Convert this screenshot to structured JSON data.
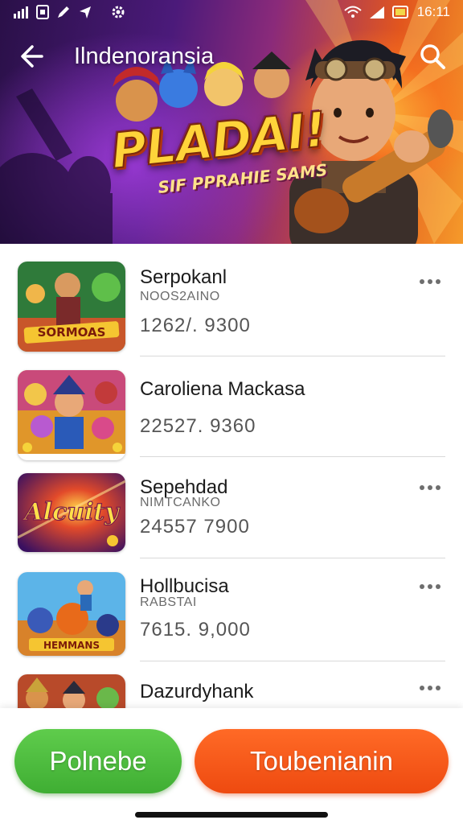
{
  "status_bar": {
    "time": "16:11",
    "icons": [
      "signal-icon",
      "sim-icon",
      "edit-icon",
      "navigation-icon",
      "settings-cog-icon",
      "wifi-icon",
      "cell-signal-icon",
      "battery-icon"
    ]
  },
  "app_bar": {
    "title": "Ilndenoransia",
    "back_icon": "arrow-left-icon",
    "search_icon": "search-icon"
  },
  "hero": {
    "logo_text": "PLADAI!",
    "tagline": "SIF PPRAHIE SAMS"
  },
  "list": {
    "items": [
      {
        "title": "Serpokanl",
        "subtitle": "NOOS2AINO",
        "number": "1262/. 9300",
        "thumb_text": "SORMOAS",
        "thumb_theme": "green-hero",
        "more_icon": "more-horizontal-icon"
      },
      {
        "title": "Caroliena Mackasa",
        "subtitle": "",
        "number": "22527. 9360",
        "thumb_text": "",
        "thumb_theme": "crowd",
        "more_icon": ""
      },
      {
        "title": "Sepehdad",
        "subtitle": "NIMTCANKO",
        "number": "24557 7900",
        "thumb_text": "Alcuity",
        "thumb_theme": "purple-logo",
        "more_icon": "more-horizontal-icon"
      },
      {
        "title": "Hollbucisa",
        "subtitle": "RABSTAI",
        "number": "7615. 9,000",
        "thumb_text": "HEMMANS",
        "thumb_theme": "sky-heroes",
        "more_icon": "more-horizontal-icon"
      },
      {
        "title": "Dazurdyhank",
        "subtitle": "",
        "number": "",
        "thumb_text": "",
        "thumb_theme": "warriors",
        "more_icon": "more-horizontal-icon"
      }
    ]
  },
  "buttons": {
    "left_label": "Polnebe",
    "right_label": "Toubenianin",
    "left_color": "#4cbb3c",
    "right_color": "#f25a18"
  }
}
